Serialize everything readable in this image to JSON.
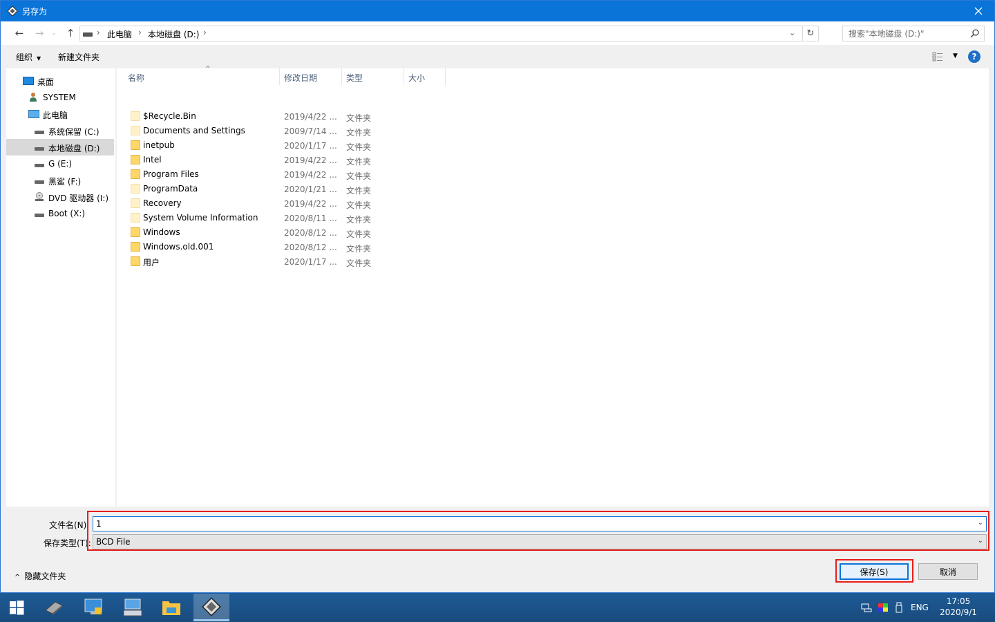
{
  "window": {
    "title": "另存为"
  },
  "nav": {
    "breadcrumbs": [
      "此电脑",
      "本地磁盘 (D:)"
    ],
    "search_placeholder": "搜索\"本地磁盘 (D:)\""
  },
  "toolbar": {
    "organize_label": "组织",
    "new_folder_label": "新建文件夹"
  },
  "sidebar": {
    "items": [
      {
        "label": "桌面",
        "icon": "desktop-icon"
      },
      {
        "label": "SYSTEM",
        "icon": "user-icon"
      },
      {
        "label": "此电脑",
        "icon": "computer-icon"
      },
      {
        "label": "系统保留 (C:)",
        "icon": "drive-icon"
      },
      {
        "label": "本地磁盘 (D:)",
        "icon": "drive-icon",
        "selected": true
      },
      {
        "label": "G (E:)",
        "icon": "drive-icon"
      },
      {
        "label": "黑鲨 (F:)",
        "icon": "drive-icon"
      },
      {
        "label": "DVD 驱动器 (I:)",
        "icon": "dvd-drive-icon"
      },
      {
        "label": "Boot (X:)",
        "icon": "drive-icon"
      }
    ]
  },
  "file_list": {
    "columns": [
      "名称",
      "修改日期",
      "类型",
      "大小"
    ],
    "rows": [
      {
        "name": "$Recycle.Bin",
        "date": "2019/4/22 ...",
        "type": "文件夹",
        "hidden": true
      },
      {
        "name": "Documents and Settings",
        "date": "2009/7/14 ...",
        "type": "文件夹",
        "hidden": true
      },
      {
        "name": "inetpub",
        "date": "2020/1/17 ...",
        "type": "文件夹",
        "hidden": false
      },
      {
        "name": "Intel",
        "date": "2019/4/22 ...",
        "type": "文件夹",
        "hidden": false
      },
      {
        "name": "Program Files",
        "date": "2019/4/22 ...",
        "type": "文件夹",
        "hidden": false
      },
      {
        "name": "ProgramData",
        "date": "2020/1/21 ...",
        "type": "文件夹",
        "hidden": true
      },
      {
        "name": "Recovery",
        "date": "2019/4/22 ...",
        "type": "文件夹",
        "hidden": true
      },
      {
        "name": "System Volume Information",
        "date": "2020/8/11 ...",
        "type": "文件夹",
        "hidden": true
      },
      {
        "name": "Windows",
        "date": "2020/8/12 ...",
        "type": "文件夹",
        "hidden": false
      },
      {
        "name": "Windows.old.001",
        "date": "2020/8/12 ...",
        "type": "文件夹",
        "hidden": false
      },
      {
        "name": "用户",
        "date": "2020/1/17 ...",
        "type": "文件夹",
        "hidden": false
      }
    ]
  },
  "save_form": {
    "filename_label": "文件名(N):",
    "filename_value": "1",
    "filetype_label": "保存类型(T):",
    "filetype_value": "BCD File",
    "hide_folders_label": "隐藏文件夹",
    "save_label": "保存(S)",
    "cancel_label": "取消"
  },
  "taskbar": {
    "apps": [
      "start-icon",
      "drive-tool-icon",
      "control-panel-icon",
      "keyboard-computer-icon",
      "file-explorer-icon",
      "bootice-icon"
    ],
    "tray_lang": "ENG",
    "time": "17:05",
    "date": "2020/9/1"
  },
  "colors": {
    "title_bar": "#0a74d8",
    "highlight_box": "#e81c1c",
    "taskbar": "#1b4f86"
  }
}
